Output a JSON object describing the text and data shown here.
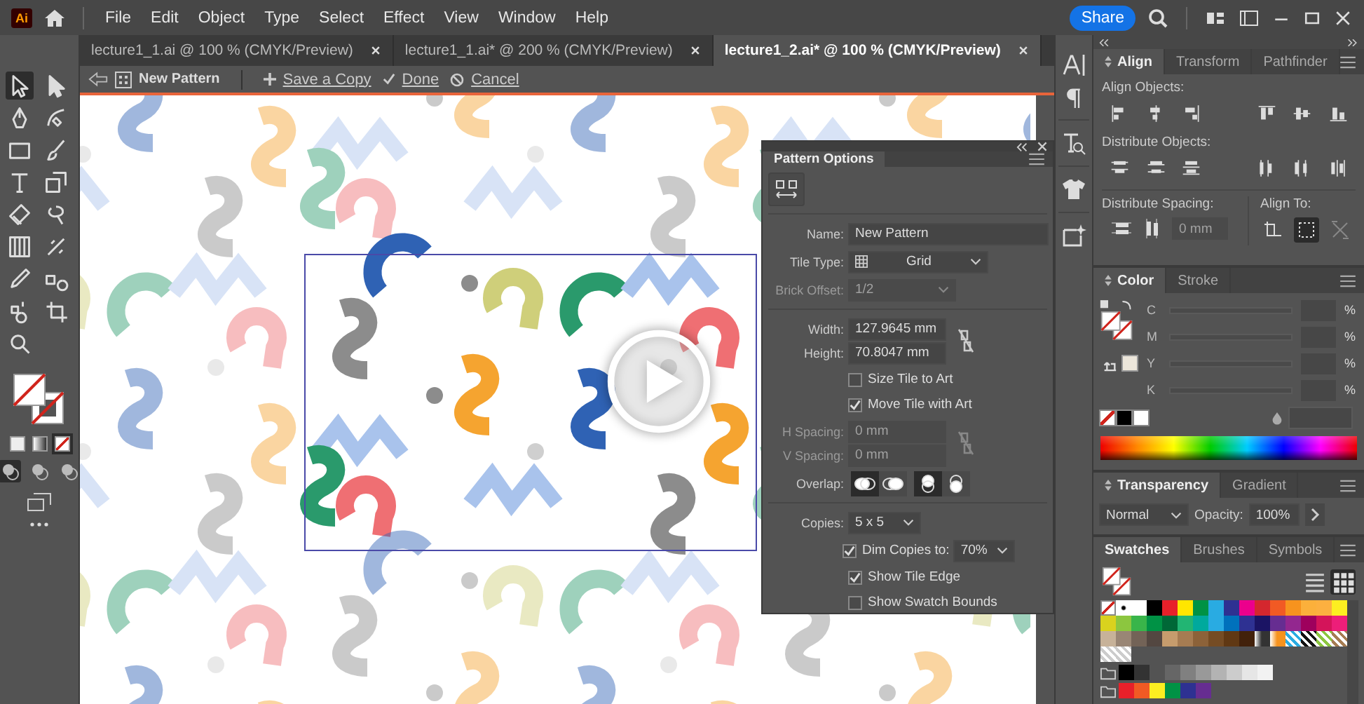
{
  "app": {
    "logo": "Ai"
  },
  "menu": [
    "File",
    "Edit",
    "Object",
    "Type",
    "Select",
    "Effect",
    "View",
    "Window",
    "Help"
  ],
  "share": "Share",
  "tabs": [
    {
      "label": "lecture1_1.ai @ 100 % (CMYK/Preview)",
      "selected": false
    },
    {
      "label": "lecture1_1.ai* @ 200 % (CMYK/Preview)",
      "selected": false
    },
    {
      "label": "lecture1_2.ai* @ 100 % (CMYK/Preview)",
      "selected": true
    }
  ],
  "pattern_bar": {
    "name": "New Pattern",
    "actions": [
      {
        "kind": "save",
        "label": "Save a Copy"
      },
      {
        "kind": "done",
        "label": "Done"
      },
      {
        "kind": "cancel",
        "label": "Cancel"
      }
    ]
  },
  "tools": [
    {
      "kind": "selection",
      "selected": true
    },
    {
      "kind": "direct-selection",
      "selected": false
    },
    {
      "kind": "pen",
      "selected": false
    },
    {
      "kind": "curvature",
      "selected": false
    },
    {
      "kind": "rectangle",
      "selected": false
    },
    {
      "kind": "paintbrush",
      "selected": false
    },
    {
      "kind": "type",
      "selected": false
    },
    {
      "kind": "scale",
      "selected": false
    },
    {
      "kind": "eraser",
      "selected": false
    },
    {
      "kind": "lasso",
      "selected": false
    },
    {
      "kind": "gradient",
      "selected": false
    },
    {
      "kind": "width",
      "selected": false
    },
    {
      "kind": "eyedropper",
      "selected": false
    },
    {
      "kind": "blend",
      "selected": false
    },
    {
      "kind": "symbol",
      "selected": false
    },
    {
      "kind": "artboard",
      "selected": false
    },
    {
      "kind": "zoom",
      "selected": false
    }
  ],
  "color_modes": [
    {
      "kind": "color",
      "selected": false
    },
    {
      "kind": "gradient",
      "selected": false
    },
    {
      "kind": "none",
      "selected": true
    }
  ],
  "draw_modes": [
    {
      "selected": true
    },
    {
      "selected": false
    },
    {
      "selected": false
    }
  ],
  "pattern_options": {
    "title": "Pattern Options",
    "fields": [
      {
        "kind": "text",
        "label": "Name:",
        "value": "New Pattern",
        "disabled": false
      },
      {
        "kind": "select",
        "label": "Tile Type:",
        "value": "Grid",
        "disabled": false
      },
      {
        "kind": "select",
        "label": "Brick Offset:",
        "value": "1/2",
        "disabled": true
      }
    ],
    "size": [
      {
        "label": "Width:",
        "value": "127.9645 mm",
        "disabled": false
      },
      {
        "label": "Height:",
        "value": "70.8047 mm",
        "disabled": false
      }
    ],
    "tile_checks": [
      {
        "label": "Size Tile to Art",
        "checked": false
      },
      {
        "label": "Move Tile with Art",
        "checked": true
      }
    ],
    "spacing": [
      {
        "label": "H Spacing:",
        "value": "0 mm",
        "disabled": true
      },
      {
        "label": "V Spacing:",
        "value": "0 mm",
        "disabled": true
      }
    ],
    "overlap_label": "Overlap:",
    "overlap": [
      [
        {
          "selected": true
        },
        {
          "selected": false
        }
      ],
      [
        {
          "selected": true
        },
        {
          "selected": false
        }
      ]
    ],
    "copies_label": "Copies:",
    "copies": "5 x 5",
    "dim": {
      "label": "Dim Copies to:",
      "checked": true,
      "value": "70%"
    },
    "view_checks": [
      {
        "label": "Show Tile Edge",
        "checked": true
      },
      {
        "label": "Show Swatch Bounds",
        "checked": false
      }
    ]
  },
  "align_panel": {
    "tabs": [
      {
        "label": "Align",
        "selected": true
      },
      {
        "label": "Transform",
        "selected": false
      },
      {
        "label": "Pathfinder",
        "selected": false
      }
    ],
    "sections": [
      "Align Objects:",
      "Distribute Objects:"
    ],
    "spacing_label": "Distribute Spacing:",
    "spacing_value": "0 mm",
    "align_to_label": "Align To:",
    "align_to": [
      {
        "selected": false
      },
      {
        "selected": true
      },
      {
        "selected": false
      }
    ]
  },
  "color_panel": {
    "tabs": [
      {
        "label": "Color",
        "selected": true
      },
      {
        "label": "Stroke",
        "selected": false
      }
    ],
    "channels": [
      {
        "label": "C",
        "unit": "%"
      },
      {
        "label": "M",
        "unit": "%"
      },
      {
        "label": "Y",
        "unit": "%"
      },
      {
        "label": "K",
        "unit": "%"
      }
    ],
    "quick_swatches": [
      {
        "kind": "none"
      },
      {
        "kind": "color",
        "color": "#000000"
      },
      {
        "kind": "color",
        "color": "#ffffff"
      }
    ]
  },
  "transparency_panel": {
    "tabs": [
      {
        "label": "Transparency",
        "selected": true
      },
      {
        "label": "Gradient",
        "selected": false
      }
    ],
    "blend_mode": "Normal",
    "opacity_label": "Opacity:",
    "opacity": "100%"
  },
  "swatches_panel": {
    "tabs": [
      {
        "label": "Swatches",
        "selected": true
      },
      {
        "label": "Brushes",
        "selected": false
      },
      {
        "label": "Symbols",
        "selected": false
      }
    ],
    "view": [
      {
        "kind": "list",
        "selected": false
      },
      {
        "kind": "grid",
        "selected": true
      }
    ],
    "rows": [
      [
        {
          "kind": "none"
        },
        {
          "kind": "registration"
        },
        {
          "kind": "color",
          "color": "#ffffff"
        },
        {
          "kind": "color",
          "color": "#000000"
        },
        {
          "kind": "color",
          "color": "#e8202a"
        },
        {
          "kind": "color",
          "color": "#ffe600"
        },
        {
          "kind": "color",
          "color": "#009245"
        },
        {
          "kind": "color",
          "color": "#29abe2"
        },
        {
          "kind": "color",
          "color": "#2e3192"
        },
        {
          "kind": "color",
          "color": "#ec008c"
        },
        {
          "kind": "color",
          "color": "#d4272e"
        },
        {
          "kind": "color",
          "color": "#f15a24"
        },
        {
          "kind": "color",
          "color": "#f7931e"
        },
        {
          "kind": "color",
          "color": "#fbb03b"
        },
        {
          "kind": "color",
          "color": "#fcb040"
        },
        {
          "kind": "color",
          "color": "#fcee21"
        }
      ],
      [
        {
          "kind": "color",
          "color": "#d9d21e"
        },
        {
          "kind": "color",
          "color": "#8cc63f"
        },
        {
          "kind": "color",
          "color": "#39b54a"
        },
        {
          "kind": "color",
          "color": "#009245"
        },
        {
          "kind": "color",
          "color": "#006837"
        },
        {
          "kind": "color",
          "color": "#22b573"
        },
        {
          "kind": "color",
          "color": "#00a99d"
        },
        {
          "kind": "color",
          "color": "#29abe2"
        },
        {
          "kind": "color",
          "color": "#0071bc"
        },
        {
          "kind": "color",
          "color": "#2e3192"
        },
        {
          "kind": "color",
          "color": "#1b1464"
        },
        {
          "kind": "color",
          "color": "#662d91"
        },
        {
          "kind": "color",
          "color": "#93278f"
        },
        {
          "kind": "color",
          "color": "#9e005d"
        },
        {
          "kind": "color",
          "color": "#d4145a"
        },
        {
          "kind": "color",
          "color": "#ed1e79"
        }
      ],
      [
        {
          "kind": "color",
          "color": "#c7b299"
        },
        {
          "kind": "color",
          "color": "#998675"
        },
        {
          "kind": "color",
          "color": "#736357"
        },
        {
          "kind": "color",
          "color": "#534741"
        },
        {
          "kind": "color",
          "color": "#c69c6d"
        },
        {
          "kind": "color",
          "color": "#a67c52"
        },
        {
          "kind": "color",
          "color": "#8c6239"
        },
        {
          "kind": "color",
          "color": "#754c24"
        },
        {
          "kind": "color",
          "color": "#603813"
        },
        {
          "kind": "color",
          "color": "#42210b"
        },
        {
          "kind": "gradient",
          "color": "#333333"
        },
        {
          "kind": "gradient",
          "color": "#f7931e"
        },
        {
          "kind": "pattern",
          "color": "#29abe2"
        },
        {
          "kind": "pattern",
          "color": "#111111"
        },
        {
          "kind": "pattern",
          "color": "#8cc63f"
        },
        {
          "kind": "pattern",
          "color": "#a67c52"
        }
      ],
      [
        {
          "kind": "pattern",
          "color": "#cccccc"
        },
        {
          "kind": "pattern",
          "color": "#cccccc"
        }
      ],
      [
        {
          "kind": "folder"
        },
        {
          "kind": "color",
          "color": "#000000"
        },
        {
          "kind": "color",
          "color": "#333333"
        },
        {
          "kind": "gap"
        },
        {
          "kind": "color",
          "color": "#666666"
        },
        {
          "kind": "color",
          "color": "#808080"
        },
        {
          "kind": "color",
          "color": "#999999"
        },
        {
          "kind": "color",
          "color": "#b3b3b3"
        },
        {
          "kind": "color",
          "color": "#cccccc"
        },
        {
          "kind": "color",
          "color": "#e6e6e6"
        },
        {
          "kind": "color",
          "color": "#f2f2f2"
        }
      ],
      [
        {
          "kind": "folder"
        },
        {
          "kind": "color",
          "color": "#e8202a"
        },
        {
          "kind": "color",
          "color": "#f15a24"
        },
        {
          "kind": "color",
          "color": "#fcee21"
        },
        {
          "kind": "color",
          "color": "#009245"
        },
        {
          "kind": "color",
          "color": "#2e3192"
        },
        {
          "kind": "color",
          "color": "#662d91"
        }
      ]
    ]
  }
}
